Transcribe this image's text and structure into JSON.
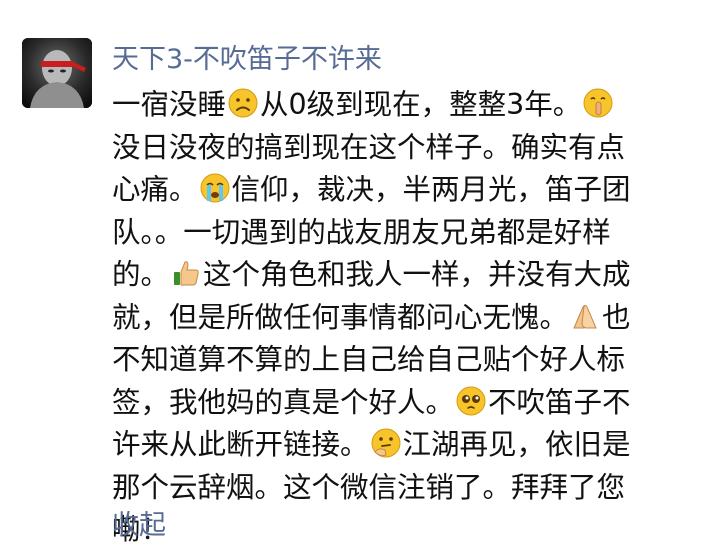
{
  "post": {
    "username": "天下3-不吹笛子不许来",
    "lines": [
      [
        "一宿没睡",
        {
          "emoji": "sad-face-icon"
        },
        "从0级到现在，整整3年。",
        {
          "emoji": "shush-face-icon"
        }
      ],
      [
        "没日没夜的搞到现在这个样子。确实有点"
      ],
      [
        "心痛。",
        {
          "emoji": "crying-face-icon"
        },
        "信仰，裁决，半两月光，笛子团"
      ],
      [
        "队。。一切遇到的战友朋友兄弟都是好样"
      ],
      [
        "的。",
        {
          "emoji": "thumbs-up-icon"
        },
        "这个角色和我人一样，并没有大成"
      ],
      [
        "就，但是所做任何事情都问心无愧。",
        {
          "emoji": "clasped-hands-icon"
        },
        "也"
      ],
      [
        "不知道算不算的上自己给自己贴个好人标"
      ],
      [
        "签，我他妈的真是个好人。",
        {
          "emoji": "pleading-face-icon"
        },
        "不吹笛子不"
      ],
      [
        "许来从此断开链接。",
        {
          "emoji": "thinking-face-icon"
        },
        "江湖再见，依旧是"
      ],
      [
        "那个云辞烟。这个微信注销了。拜拜了您"
      ],
      [
        "嘞！"
      ]
    ],
    "collapse_label": "收起"
  },
  "colors": {
    "link": "#576b95",
    "text": "#111111",
    "emoji_yellow": "#f7c52b"
  }
}
